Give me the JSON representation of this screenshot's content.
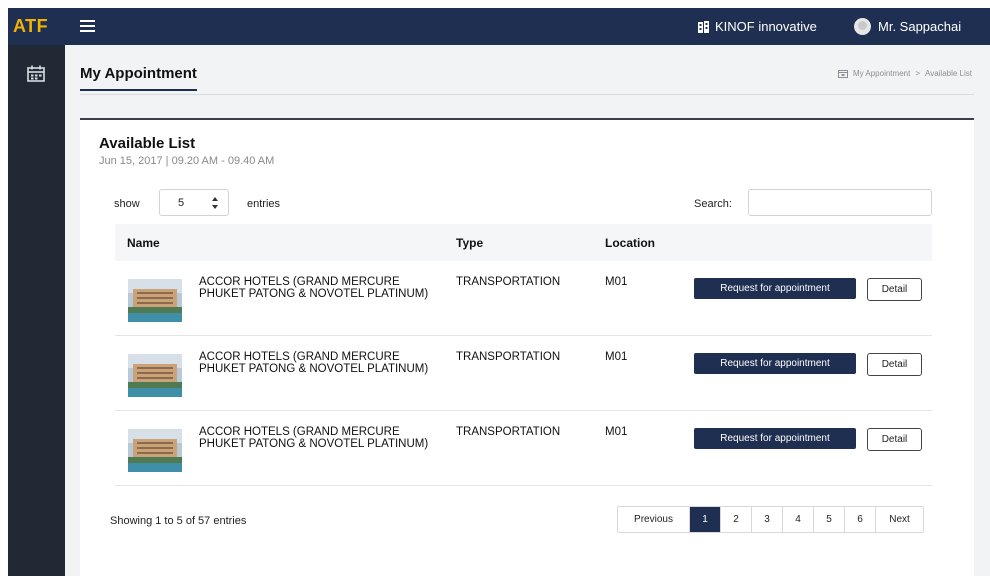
{
  "app": {
    "brand": "ATF"
  },
  "header": {
    "company": "KINOF innovative",
    "user": "Mr. Sappachai"
  },
  "page": {
    "title": "My Appointment",
    "breadcrumb": [
      "My Appointment",
      ">",
      "Available List"
    ]
  },
  "list": {
    "title": "Available List",
    "subtitle": "Jun 15, 2017 | 09.20 AM - 09.40 AM",
    "show_label": "show",
    "entries_value": "5",
    "entries_label": "entries",
    "search_label": "Search:",
    "search_value": "",
    "columns": [
      "Name",
      "Type",
      "Location"
    ],
    "rows": [
      {
        "name": "ACCOR HOTELS (GRAND MERCURE PHUKET PATONG & NOVOTEL PLATINUM)",
        "type": "TRANSPORTATION",
        "location": "M01",
        "request_label": "Request for appointment",
        "detail_label": "Detail"
      },
      {
        "name": "ACCOR HOTELS (GRAND MERCURE PHUKET PATONG & NOVOTEL PLATINUM)",
        "type": "TRANSPORTATION",
        "location": "M01",
        "request_label": "Request for appointment",
        "detail_label": "Detail"
      },
      {
        "name": "ACCOR HOTELS (GRAND MERCURE PHUKET PATONG & NOVOTEL PLATINUM)",
        "type": "TRANSPORTATION",
        "location": "M01",
        "request_label": "Request for appointment",
        "detail_label": "Detail"
      }
    ],
    "footer": {
      "showing": "Showing 1 to 5 of 57 entries",
      "pagination": {
        "previous": "Previous",
        "pages": [
          "1",
          "2",
          "3",
          "4",
          "5",
          "6"
        ],
        "active_page": "1",
        "next": "Next"
      }
    }
  },
  "icons": {
    "menu": "hamburger-menu-icon",
    "company": "building-icon",
    "user": "user-avatar-icon",
    "sidebar": "calendar-icon",
    "breadcrumb": "calendar-icon",
    "select": "sort-arrows-icon"
  },
  "colors": {
    "topbar": "#1f2f52",
    "brand": "#f2b200",
    "sidebar": "#212a34",
    "primary_button": "#1f2f52",
    "page_background": "#f2f3f5"
  }
}
